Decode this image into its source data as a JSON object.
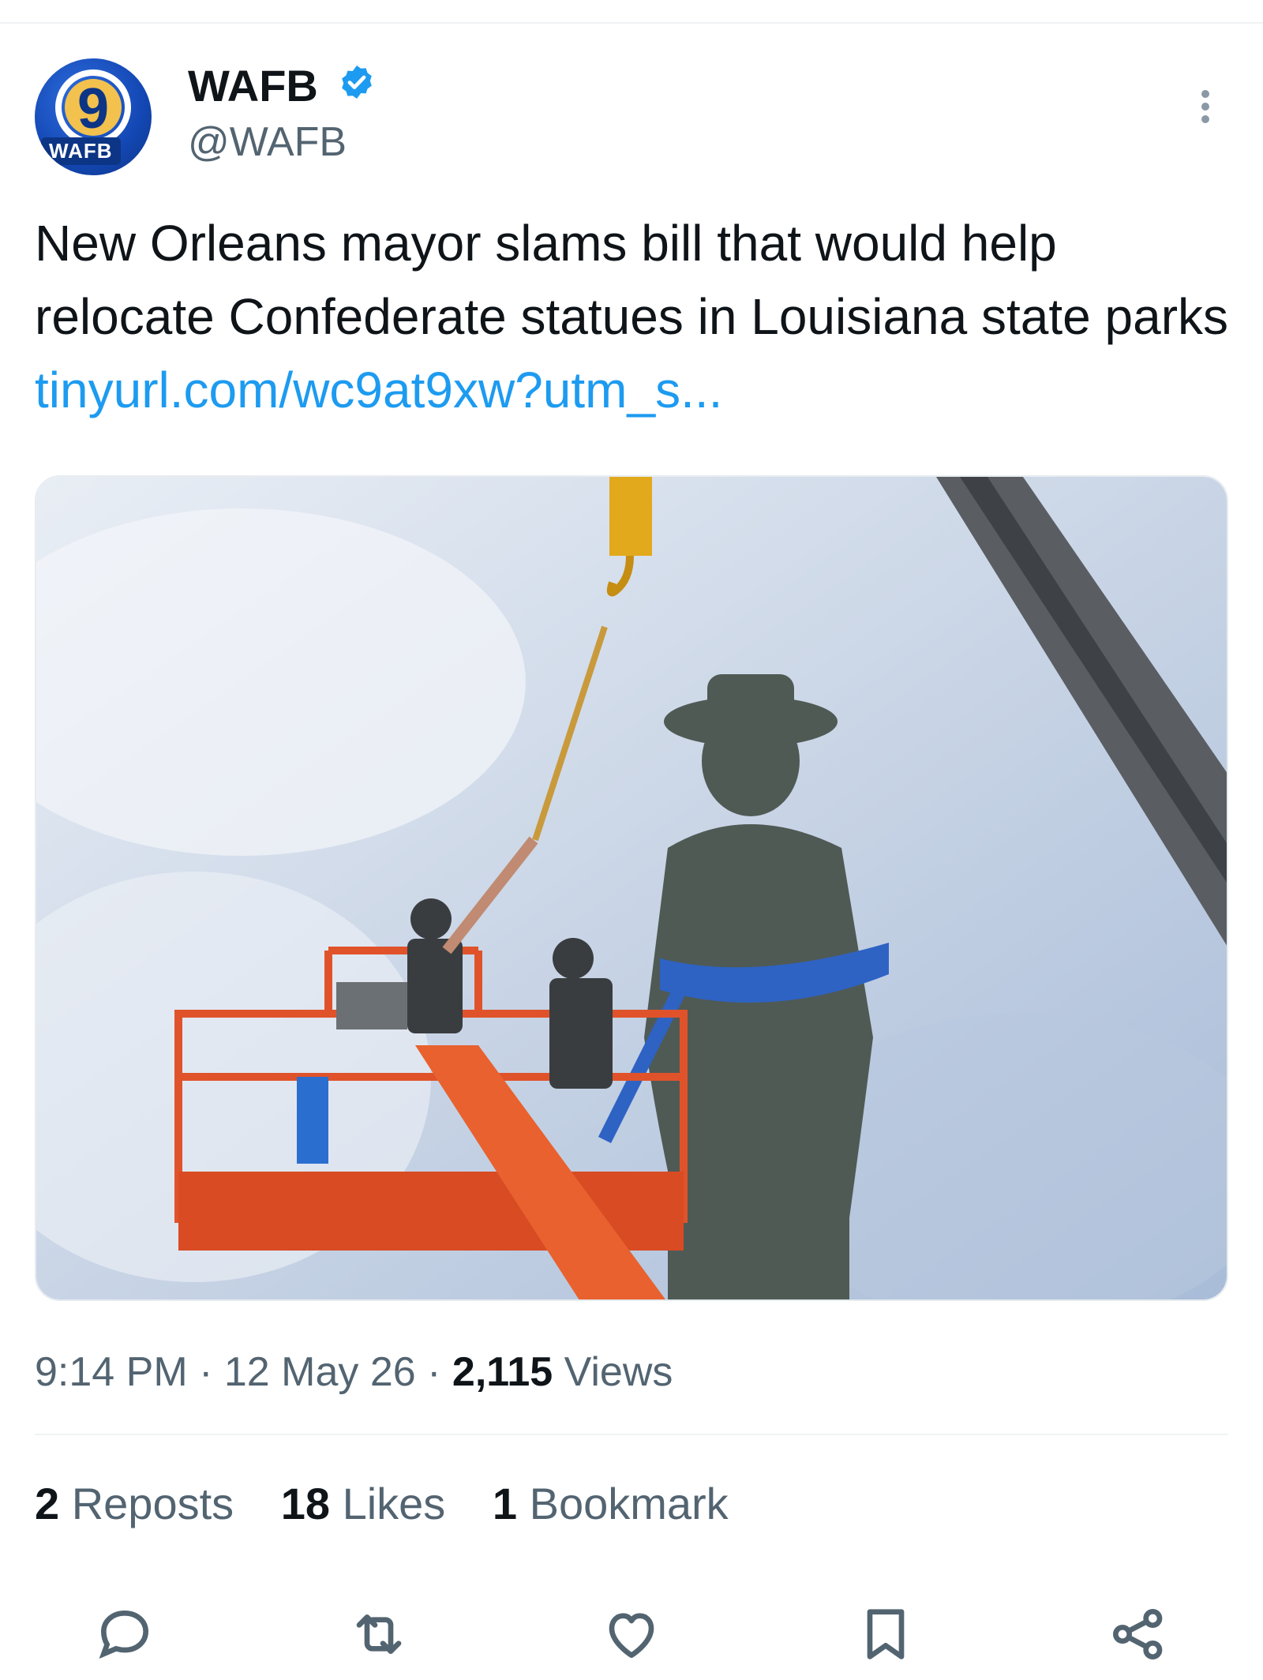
{
  "account": {
    "avatar_number": "9",
    "avatar_label": "WAFB",
    "display_name": "WAFB",
    "handle": "@WAFB"
  },
  "tweet": {
    "text": "New Orleans mayor slams bill that would help relocate Confederate statues in Louisiana state parks",
    "link": "tinyurl.com/wc9at9xw?utm_s..."
  },
  "meta": {
    "time": "9:14 PM",
    "separator": " · ",
    "date": "12 May 26",
    "views_count": "2,115",
    "views_label": "Views"
  },
  "stats": {
    "reposts_count": "2",
    "reposts_label": "Reposts",
    "likes_count": "18",
    "likes_label": "Likes",
    "bookmarks_count": "1",
    "bookmarks_label": "Bookmark"
  },
  "icons": {
    "verified": "verified-badge-icon",
    "more": "more-vertical-icon",
    "reply": "reply-icon",
    "repost": "repost-icon",
    "like": "heart-icon",
    "bookmark": "bookmark-icon",
    "share": "share-icon"
  },
  "colors": {
    "link": "#1d9bf0",
    "verified": "#1d9bf0",
    "secondary_text": "#536471",
    "icon": "#536471"
  }
}
